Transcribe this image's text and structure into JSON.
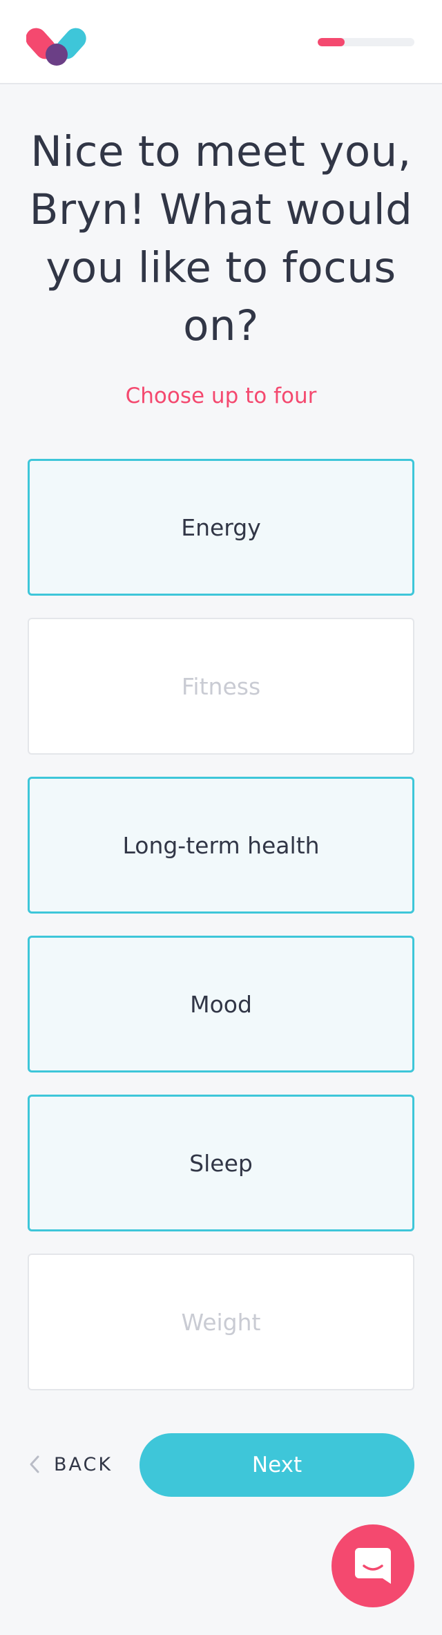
{
  "header": {
    "logo_icon": "heart-pill-logo",
    "progress": 0.28,
    "colors": {
      "progress_fill": "#f4496f",
      "progress_track": "#eef0f3"
    }
  },
  "main": {
    "title": "Nice to meet you, Bryn! What would you like to focus on?",
    "subtitle": "Choose up to four",
    "options": [
      {
        "label": "Energy",
        "selected": true
      },
      {
        "label": "Fitness",
        "selected": false
      },
      {
        "label": "Long-term health",
        "selected": true
      },
      {
        "label": "Mood",
        "selected": true
      },
      {
        "label": "Sleep",
        "selected": true
      },
      {
        "label": "Weight",
        "selected": false
      }
    ]
  },
  "footer": {
    "back_label": "BACK",
    "next_label": "Next",
    "back_icon": "chevron-left-icon",
    "chat_icon": "chat-icon"
  },
  "colors": {
    "accent": "#3ec6d9",
    "brand_pink": "#f4496f",
    "text": "#313646",
    "muted_text": "#c9cbd3",
    "background": "#f6f7f9"
  }
}
